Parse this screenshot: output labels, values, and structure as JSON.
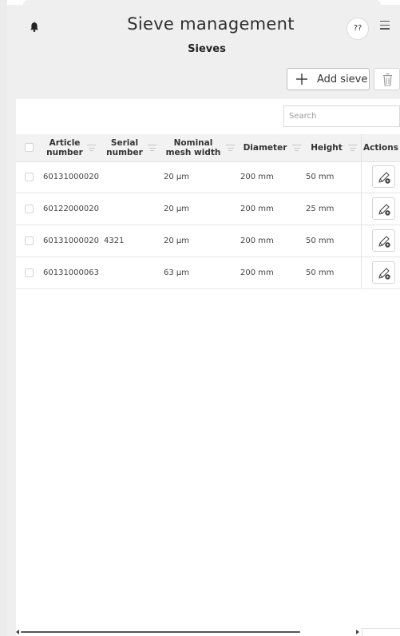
{
  "header": {
    "title": "Sieve management",
    "subtitle": "Sieves",
    "help_label": "??"
  },
  "toolbar": {
    "add_label": "Add sieve"
  },
  "search": {
    "placeholder": "Search"
  },
  "table": {
    "columns": [
      {
        "line1": "Article",
        "line2": "number"
      },
      {
        "line1": "Serial",
        "line2": "number"
      },
      {
        "line1": "Nominal",
        "line2": "mesh width"
      },
      {
        "line1": "Diameter",
        "line2": ""
      },
      {
        "line1": "Height",
        "line2": ""
      },
      {
        "line1": "Actions",
        "line2": ""
      }
    ],
    "rows": [
      {
        "article": "60131000020",
        "serial": "",
        "mesh": "20 μm",
        "diameter": "200 mm",
        "height": "50 mm"
      },
      {
        "article": "60122000020",
        "serial": "",
        "mesh": "20 μm",
        "diameter": "200 mm",
        "height": "25 mm"
      },
      {
        "article": "60131000020",
        "serial": "4321",
        "mesh": "20 μm",
        "diameter": "200 mm",
        "height": "50 mm"
      },
      {
        "article": "60131000063",
        "serial": "",
        "mesh": "63 μm",
        "diameter": "200 mm",
        "height": "50 mm"
      }
    ]
  },
  "icons": {
    "notifications": "bell-icon",
    "menu": "hamburger-menu-icon",
    "add": "plus-icon",
    "delete": "trash-icon",
    "filter": "filter-icon",
    "edit": "edit-pencil-gear-icon"
  }
}
